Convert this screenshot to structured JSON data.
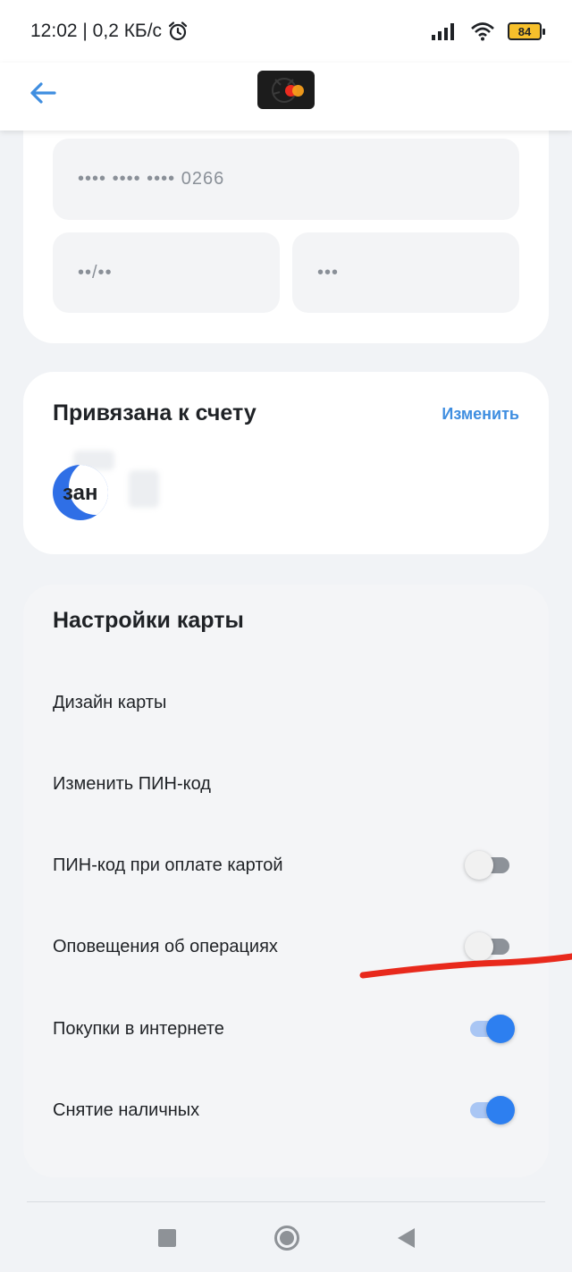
{
  "status_bar": {
    "time_speed": "12:02 | 0,2 КБ/с",
    "battery": "84"
  },
  "card": {
    "number_masked": "•••• •••• •••• 0266",
    "expiry_masked": "••/••",
    "cvv_masked": "•••"
  },
  "account": {
    "title": "Привязана к счету",
    "change_label": "Изменить",
    "name": "зан"
  },
  "settings": {
    "title": "Настройки карты",
    "items": [
      {
        "label": "Дизайн карты"
      },
      {
        "label": "Изменить ПИН-код"
      },
      {
        "label": "ПИН-код при оплате картой",
        "enabled": false
      },
      {
        "label": "Оповещения об операциях",
        "enabled": false
      },
      {
        "label": "Покупки в интернете",
        "enabled": true
      },
      {
        "label": "Снятие наличных",
        "enabled": true
      }
    ]
  },
  "colors": {
    "accent": "#2d7ff0",
    "link": "#3f8ee0",
    "annotation": "#e8291c"
  },
  "icons": {
    "back": "arrow-left-icon",
    "alarm": "alarm-clock-icon",
    "signal": "signal-icon",
    "wifi": "wifi-icon",
    "battery": "battery-icon",
    "mastercard": "mastercard-logo-icon"
  }
}
